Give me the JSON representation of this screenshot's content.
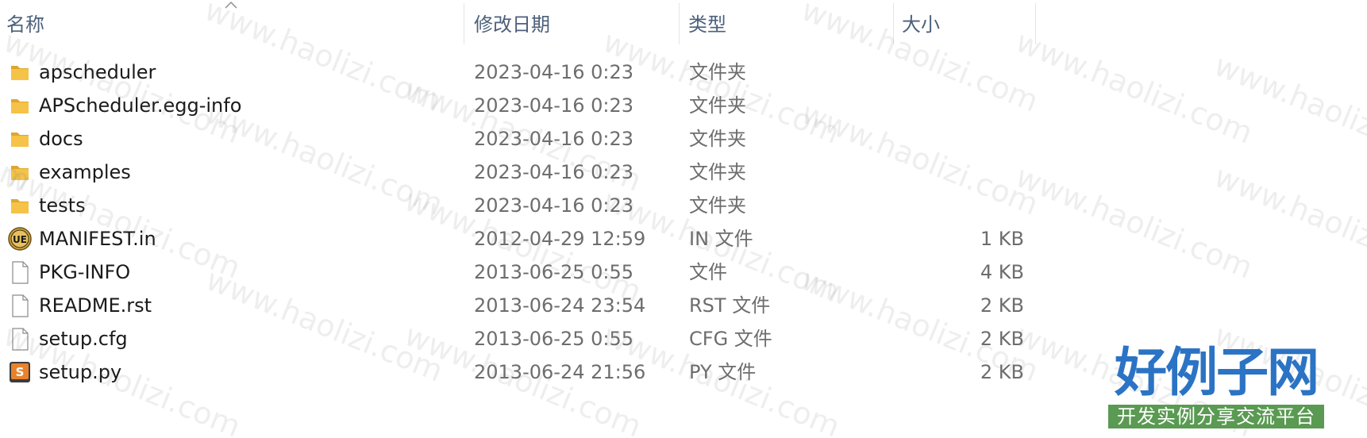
{
  "columns": {
    "name": "名称",
    "date": "修改日期",
    "type": "类型",
    "size": "大小"
  },
  "files": [
    {
      "name": "apscheduler",
      "date": "2023-04-16 0:23",
      "type": "文件夹",
      "size": "",
      "icon": "folder-icon"
    },
    {
      "name": "APScheduler.egg-info",
      "date": "2023-04-16 0:23",
      "type": "文件夹",
      "size": "",
      "icon": "folder-icon"
    },
    {
      "name": "docs",
      "date": "2023-04-16 0:23",
      "type": "文件夹",
      "size": "",
      "icon": "folder-icon"
    },
    {
      "name": "examples",
      "date": "2023-04-16 0:23",
      "type": "文件夹",
      "size": "",
      "icon": "folder-icon"
    },
    {
      "name": "tests",
      "date": "2023-04-16 0:23",
      "type": "文件夹",
      "size": "",
      "icon": "folder-icon"
    },
    {
      "name": "MANIFEST.in",
      "date": "2012-04-29 12:59",
      "type": "IN 文件",
      "size": "1 KB",
      "icon": "ultraedit-file-icon"
    },
    {
      "name": "PKG-INFO",
      "date": "2013-06-25 0:55",
      "type": "文件",
      "size": "4 KB",
      "icon": "blank-file-icon"
    },
    {
      "name": "README.rst",
      "date": "2013-06-24 23:54",
      "type": "RST 文件",
      "size": "2 KB",
      "icon": "blank-file-icon"
    },
    {
      "name": "setup.cfg",
      "date": "2013-06-25 0:55",
      "type": "CFG 文件",
      "size": "2 KB",
      "icon": "blank-file-icon"
    },
    {
      "name": "setup.py",
      "date": "2013-06-24 21:56",
      "type": "PY 文件",
      "size": "2 KB",
      "icon": "sublime-file-icon"
    }
  ],
  "watermark": {
    "text": "www.haolizi.com"
  },
  "brand": {
    "title": "好例子网",
    "subtitle": "开发实例分享交流平台"
  },
  "colors": {
    "header_text": "#4c607a",
    "name_text": "#1a1a1a",
    "meta_text": "#6d6d6d",
    "folder": "#f5c348",
    "brand_blue": "#2b73c4",
    "brand_green": "#5a9a52"
  }
}
